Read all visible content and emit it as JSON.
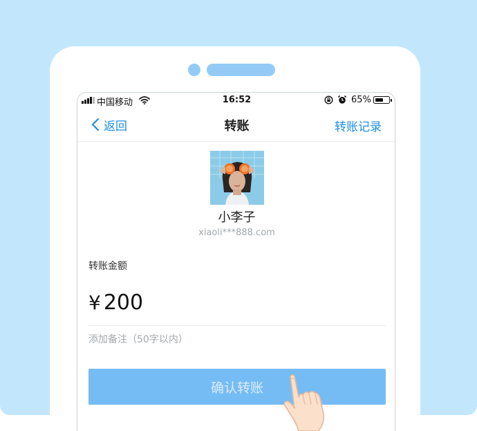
{
  "status_bar": {
    "carrier": "中国移动",
    "time": "16:52",
    "battery_percent": "65%",
    "battery_level": 0.65
  },
  "nav": {
    "back_label": "返回",
    "title": "转账",
    "history_label": "转账记录"
  },
  "recipient": {
    "name": "小李子",
    "account": "xiaoli***888.com"
  },
  "amount": {
    "label": "转账金额",
    "currency": "¥",
    "value": "200"
  },
  "note": {
    "placeholder": "添加备注（50字以内）"
  },
  "confirm_label": "确认转账",
  "colors": {
    "background": "#c2e7fd",
    "accent": "#1b8fe6",
    "button": "#76bcf4",
    "phone_details": "#93cbf6"
  },
  "icons": [
    "chevron-left-icon",
    "signal-icon",
    "wifi-icon",
    "rotation-lock-icon",
    "alarm-icon",
    "battery-icon",
    "pointing-hand-icon"
  ]
}
